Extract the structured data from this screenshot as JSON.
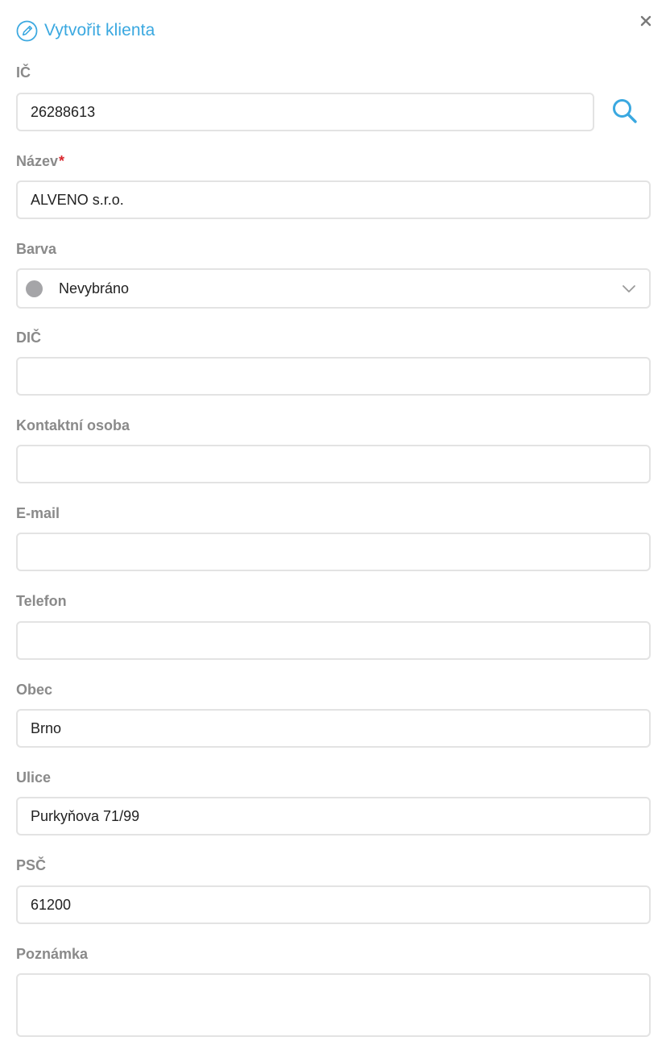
{
  "dialog": {
    "title": "Vytvořit klienta",
    "accent_color": "#3aa8e0"
  },
  "fields": {
    "ic": {
      "label": "IČ",
      "value": "26288613"
    },
    "nazev": {
      "label": "Název",
      "required_mark": "*",
      "value": "ALVENO s.r.o."
    },
    "barva": {
      "label": "Barva",
      "value": "Nevybráno",
      "dot_color": "#a5a5a8"
    },
    "dic": {
      "label": "DIČ",
      "value": ""
    },
    "kontakt": {
      "label": "Kontaktní osoba",
      "value": ""
    },
    "email": {
      "label": "E-mail",
      "value": ""
    },
    "telefon": {
      "label": "Telefon",
      "value": ""
    },
    "obec": {
      "label": "Obec",
      "value": "Brno"
    },
    "ulice": {
      "label": "Ulice",
      "value": "Purkyňova 71/99"
    },
    "psc": {
      "label": "PSČ",
      "value": "61200"
    },
    "poznamka": {
      "label": "Poznámka",
      "value": ""
    }
  },
  "icons": {
    "title": "pencil-icon",
    "close": "close-icon",
    "search": "search-icon",
    "select": "chevron-down-icon"
  }
}
